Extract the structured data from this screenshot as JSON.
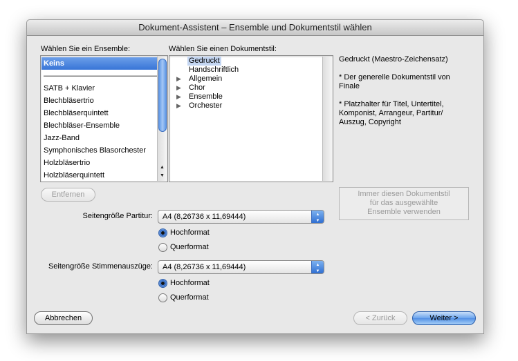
{
  "window": {
    "title": "Dokument-Assistent – Ensemble und Dokumentstil wählen"
  },
  "ensemble": {
    "label": "Wählen Sie ein Ensemble:",
    "items": [
      {
        "text": "Keins",
        "selected": true
      },
      {
        "text": "———————————————",
        "selected": false
      },
      {
        "text": "SATB + Klavier",
        "selected": false
      },
      {
        "text": "Blechbläsertrio",
        "selected": false
      },
      {
        "text": "Blechbläserquintett",
        "selected": false
      },
      {
        "text": "Blechbläser-Ensemble",
        "selected": false
      },
      {
        "text": "Jazz-Band",
        "selected": false
      },
      {
        "text": "Symphonisches Blasorchester",
        "selected": false
      },
      {
        "text": "Holzbläsertrio",
        "selected": false
      },
      {
        "text": "Holzbläserquintett",
        "selected": false
      }
    ],
    "remove_button": "Entfernen"
  },
  "docstyle": {
    "label": "Wählen Sie einen Dokumentstil:",
    "items": [
      {
        "text": "Gedruckt",
        "selected": true,
        "expandable": false
      },
      {
        "text": "Handschriftlich",
        "selected": false,
        "expandable": false
      },
      {
        "text": "Allgemein",
        "selected": false,
        "expandable": true
      },
      {
        "text": "Chor",
        "selected": false,
        "expandable": true
      },
      {
        "text": "Ensemble",
        "selected": false,
        "expandable": true
      },
      {
        "text": "Orchester",
        "selected": false,
        "expandable": true
      }
    ]
  },
  "description": {
    "title": "Gedruckt (Maestro-Zeichensatz)",
    "line1": "* Der generelle Dokumentstil von",
    "line2": "Finale",
    "line3": "* Platzhalter für Titel, Untertitel,",
    "line4": "Komponist, Arrangeur, Partitur/",
    "line5": "Auszug, Copyright"
  },
  "always_button": {
    "line1": "Immer diesen Dokumentstil",
    "line2": "für das ausgewählte",
    "line3": "Ensemble verwenden"
  },
  "score_page": {
    "label": "Seitengröße Partitur:",
    "value": "A4 (8,26736 x 11,69444)",
    "portrait": "Hochformat",
    "landscape": "Querformat",
    "orientation": "portrait"
  },
  "parts_page": {
    "label": "Seitengröße Stimmenauszüge:",
    "value": "A4 (8,26736 x 11,69444)",
    "portrait": "Hochformat",
    "landscape": "Querformat",
    "orientation": "portrait"
  },
  "footer": {
    "cancel": "Abbrechen",
    "back": "< Zurück",
    "next": "Weiter >"
  },
  "colors": {
    "selection": "#3875d7",
    "default_button": "#5390e4"
  }
}
